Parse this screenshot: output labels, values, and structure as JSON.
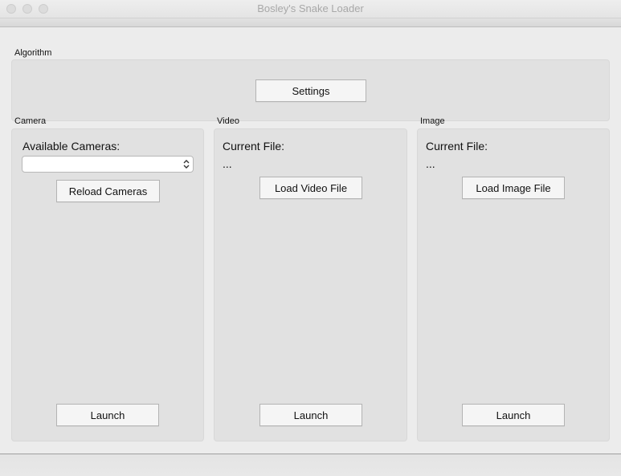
{
  "window": {
    "title": "Bosley's Snake Loader"
  },
  "algorithm": {
    "label": "Algorithm",
    "settings_button": "Settings"
  },
  "camera": {
    "label": "Camera",
    "available_label": "Available Cameras:",
    "select_value": "",
    "reload_button": "Reload Cameras",
    "launch_button": "Launch"
  },
  "video": {
    "label": "Video",
    "current_file_label": "Current File:",
    "current_file_value": "...",
    "load_button": "Load Video File",
    "launch_button": "Launch"
  },
  "image": {
    "label": "Image",
    "current_file_label": "Current File:",
    "current_file_value": "...",
    "load_button": "Load Image File",
    "launch_button": "Launch"
  }
}
